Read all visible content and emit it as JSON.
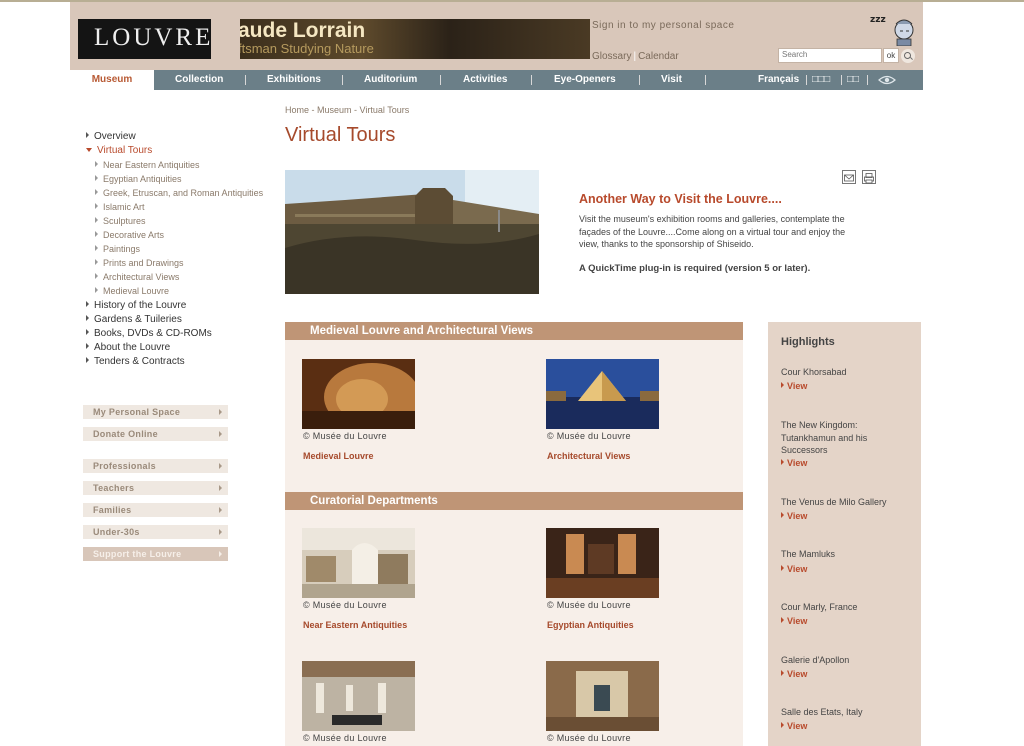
{
  "header": {
    "logo_text": "LOUVRE",
    "banner_title": "aude Lorrain",
    "banner_subtitle": "ftsman Studying Nature",
    "signin": "Sign in to my personal space",
    "glossary": "Glossary",
    "calendar": "Calendar",
    "search_placeholder": "Search",
    "search_ok": "ok"
  },
  "nav": {
    "museum": "Museum",
    "collection": "Collection",
    "exhibitions": "Exhibitions",
    "auditorium": "Auditorium",
    "activities": "Activities",
    "eye_openers": "Eye-Openers",
    "visit": "Visit",
    "francais": "Français",
    "lang2": "□□□",
    "lang3": "□□"
  },
  "breadcrumb": "Home - Museum - Virtual Tours",
  "page_title": "Virtual Tours",
  "left_nav": {
    "overview": "Overview",
    "virtual_tours": "Virtual Tours",
    "subs": [
      "Near Eastern Antiquities",
      "Egyptian Antiquities",
      "Greek, Etruscan, and Roman Antiquities",
      "Islamic Art",
      "Sculptures",
      "Decorative Arts",
      "Paintings",
      "Prints and Drawings",
      "Architectural Views",
      "Medieval Louvre"
    ],
    "history": "History of the Louvre",
    "gardens": "Gardens & Tuileries",
    "books": "Books, DVDs & CD-ROMs",
    "about": "About the Louvre",
    "tenders": "Tenders & Contracts"
  },
  "side_buttons": {
    "personal": "My Personal Space",
    "donate": "Donate Online",
    "professionals": "Professionals",
    "teachers": "Teachers",
    "families": "Families",
    "under30": "Under-30s",
    "support": "Support the Louvre"
  },
  "intro": {
    "title": "Another Way to Visit the Louvre....",
    "text": "Visit the museum's exhibition rooms and galleries, contemplate the façades of the Louvre....Come along on a virtual tour and enjoy the view, thanks to the sponsorship of Shiseido.",
    "note": "A QuickTime plug-in is required (version 5 or later)."
  },
  "sections": {
    "medieval_header": "Medieval Louvre and Architectural Views",
    "curatorial_header": "Curatorial Departments",
    "copyright": "© Musée du Louvre",
    "medieval_link": "Medieval Louvre",
    "architectural_link": "Architectural Views",
    "near_eastern_link": "Near Eastern Antiquities",
    "egyptian_link": "Egyptian Antiquities"
  },
  "highlights": {
    "title": "Highlights",
    "view": "View",
    "items": [
      "Cour Khorsabad",
      "The New Kingdom: Tutankhamun and his Successors",
      "The Venus de Milo Gallery",
      "The Mamluks",
      "Cour Marly, France",
      "Galerie d'Apollon",
      "Salle des Etats, Italy"
    ]
  }
}
